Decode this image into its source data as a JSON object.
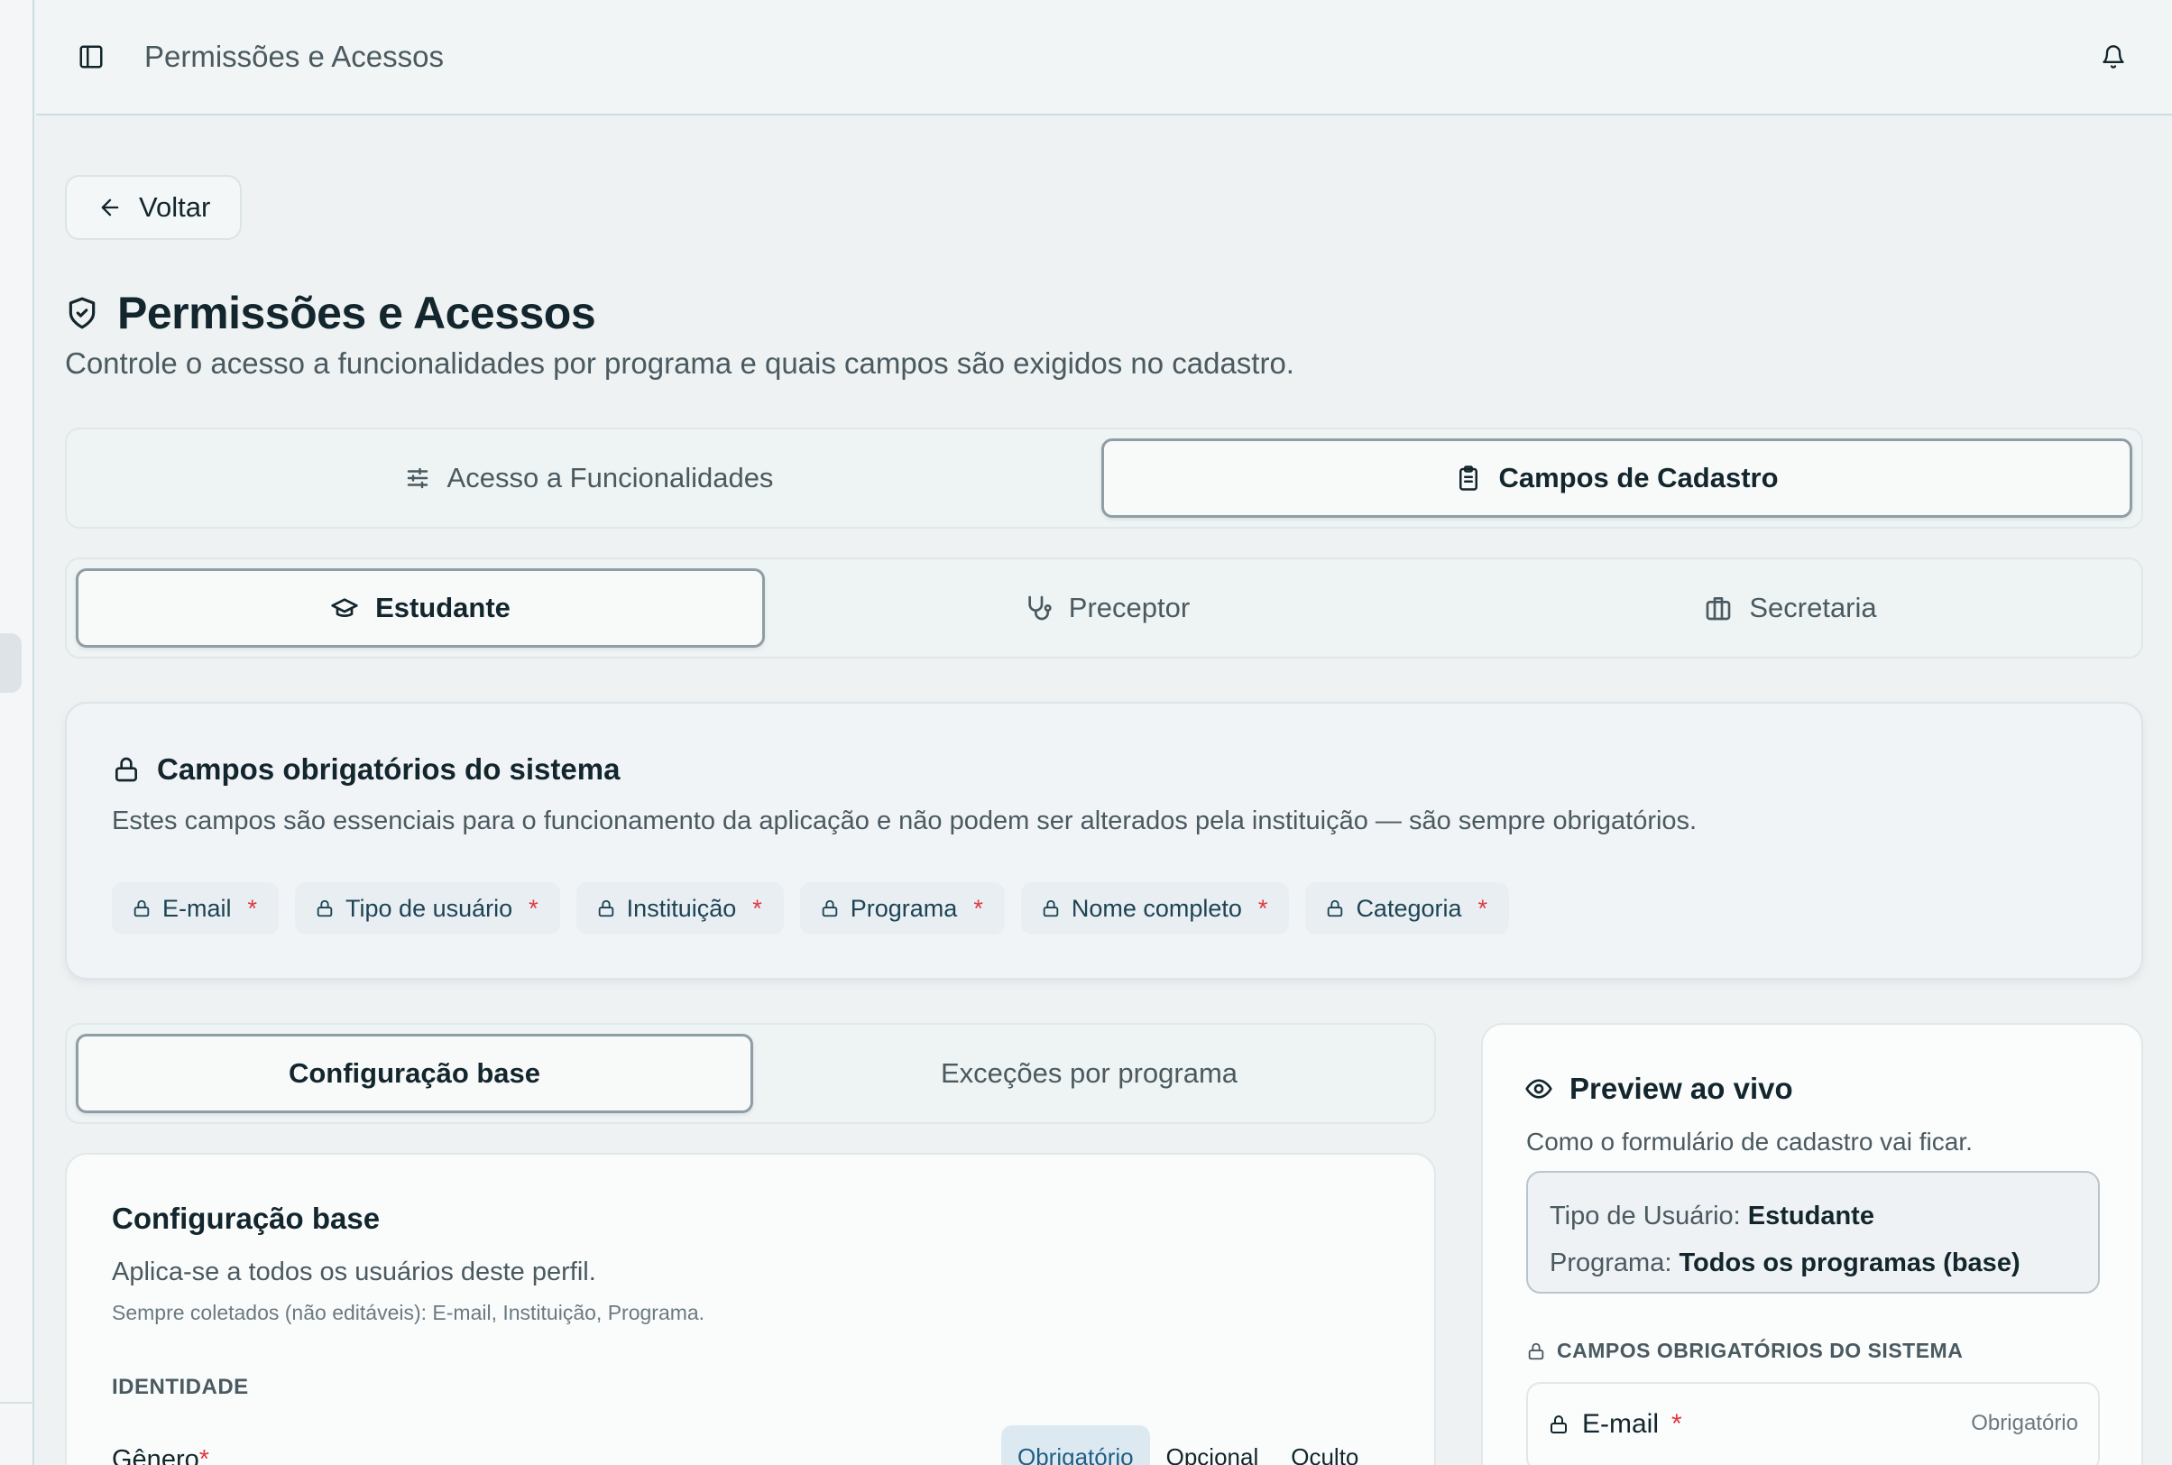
{
  "topbar": {
    "title": "Permissões e Acessos",
    "sidebar_icon": "sidebar-toggle-icon",
    "bell_icon": "bell-icon"
  },
  "back_button": {
    "label": "Voltar"
  },
  "page": {
    "title": "Permissões e Acessos",
    "subtitle": "Controle o acesso a funcionalidades por programa e quais campos são exigidos no cadastro."
  },
  "main_tabs": [
    {
      "label": "Acesso a Funcionalidades",
      "icon": "sliders-icon",
      "active": false
    },
    {
      "label": "Campos de Cadastro",
      "icon": "clipboard-icon",
      "active": true
    }
  ],
  "role_tabs": [
    {
      "label": "Estudante",
      "icon": "graduation-cap-icon",
      "active": true
    },
    {
      "label": "Preceptor",
      "icon": "stethoscope-icon",
      "active": false
    },
    {
      "label": "Secretaria",
      "icon": "briefcase-icon",
      "active": false
    }
  ],
  "system_fields": {
    "title": "Campos obrigatórios do sistema",
    "description": "Estes campos são essenciais para o funcionamento da aplicação e não podem ser alterados pela instituição — são sempre obrigatórios.",
    "required_mark": "*",
    "chips": [
      "E-mail",
      "Tipo de usuário",
      "Instituição",
      "Programa",
      "Nome completo",
      "Categoria"
    ]
  },
  "config_tabs": [
    {
      "label": "Configuração base",
      "active": true
    },
    {
      "label": "Exceções por programa",
      "active": false
    }
  ],
  "config": {
    "title": "Configuração base",
    "applies": "Aplica-se a todos os usuários deste perfil.",
    "always_collected": "Sempre coletados (não editáveis): E-mail, Instituição, Programa.",
    "section": "IDENTIDADE",
    "field": {
      "label": "Gênero",
      "required_mark": "*"
    },
    "options": [
      {
        "label": "Obrigatório",
        "active": true
      },
      {
        "label": "Opcional",
        "active": false
      },
      {
        "label": "Oculto",
        "active": false
      }
    ]
  },
  "preview": {
    "title": "Preview ao vivo",
    "description": "Como o formulário de cadastro vai ficar.",
    "user_type_label": "Tipo de Usuário:",
    "user_type_value": "Estudante",
    "program_label": "Programa:",
    "program_value": "Todos os programas (base)",
    "section": "CAMPOS OBRIGATÓRIOS DO SISTEMA",
    "field": {
      "name": "E-mail",
      "required_mark": "*",
      "status": "Obrigatório"
    }
  },
  "colors": {
    "background": "#eef2f3",
    "text": "#13262d",
    "required": "#e0393e",
    "chip_text": "#1d4454",
    "option_active": "#1f5f86"
  }
}
